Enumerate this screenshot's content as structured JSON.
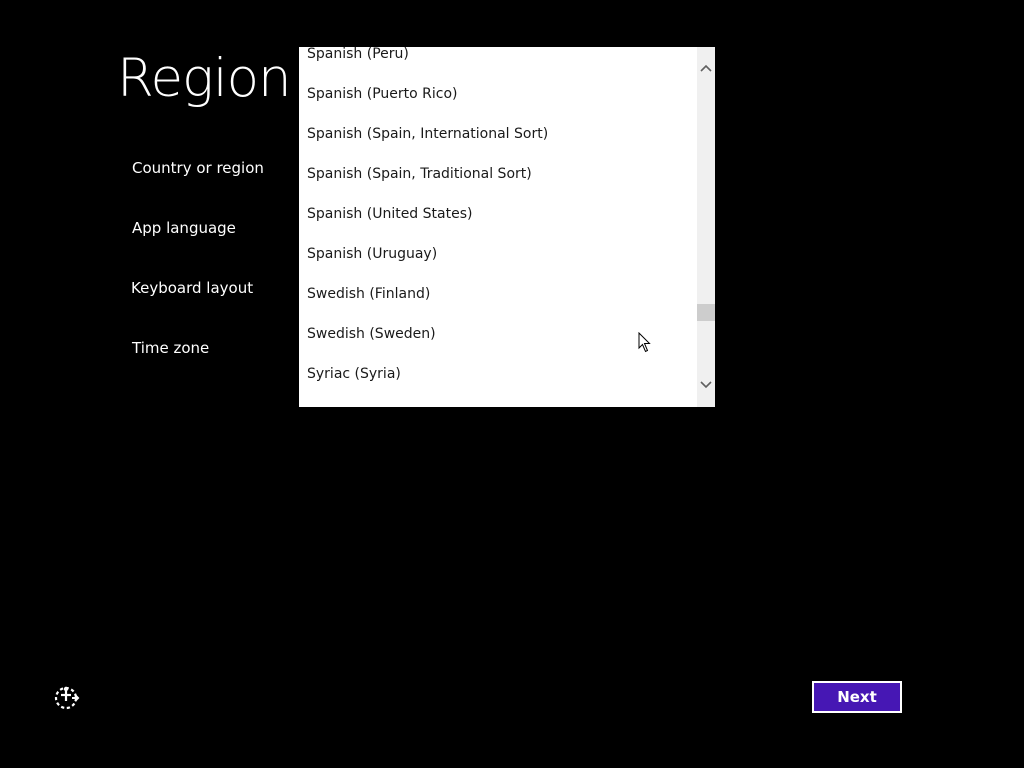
{
  "page": {
    "title": "Region"
  },
  "settings": [
    {
      "label": "Country or region"
    },
    {
      "label": "App language"
    },
    {
      "label": "Keyboard layout"
    },
    {
      "label": "Time zone"
    }
  ],
  "dropdown": {
    "options": [
      {
        "label": "Spanish (Peru)"
      },
      {
        "label": "Spanish (Puerto Rico)"
      },
      {
        "label": "Spanish (Spain, International Sort)"
      },
      {
        "label": "Spanish (Spain, Traditional Sort)"
      },
      {
        "label": "Spanish (United States)"
      },
      {
        "label": "Spanish (Uruguay)"
      },
      {
        "label": "Swedish (Finland)"
      },
      {
        "label": "Swedish (Sweden)"
      },
      {
        "label": "Syriac (Syria)"
      }
    ],
    "scroll_position": 0.81
  },
  "footer": {
    "next_label": "Next",
    "ease_of_access_icon": "ease-of-access-icon"
  },
  "colors": {
    "background": "#000000",
    "accent": "#4617b4",
    "list_background": "#ffffff",
    "list_text": "#1a1a1a"
  }
}
